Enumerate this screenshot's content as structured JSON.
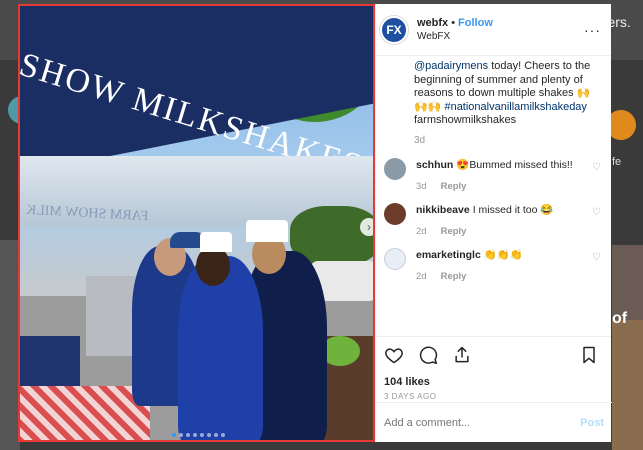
{
  "background": {
    "top_right_text": "omers.",
    "right_text": "fe",
    "right_big_text": "of"
  },
  "post": {
    "banner_text": "SHOW MILKSHAKES",
    "under_text": "FARM SHOW MILK"
  },
  "header": {
    "avatar_text": "FX",
    "username": "webfx",
    "bullet": "•",
    "follow_label": "Follow",
    "subname": "WebFX",
    "more_label": "···"
  },
  "caption": {
    "mention": "@padairymens",
    "text": " today! Cheers to the beginning of summer and plenty of reasons to down multiple shakes 🙌🙌🙌 ",
    "hashtag": "#nationalvanillamilkshakeday",
    "tail": " farmshowmilkshakes",
    "time": "3d"
  },
  "comments": [
    {
      "user": "schhun",
      "text": "😍Bummed missed this!!",
      "time": "3d",
      "reply": "Reply",
      "avatar_color": "#8a9aa6"
    },
    {
      "user": "nikkibeave",
      "text": "I missed it too 😂",
      "time": "2d",
      "reply": "Reply",
      "avatar_color": "#6b3b2c"
    },
    {
      "user": "emarketinglc",
      "text": "👏👏👏",
      "time": "2d",
      "reply": "Reply",
      "avatar_color": "#e7eef5"
    }
  ],
  "actions": {
    "likes": "104 likes",
    "date": "3 DAYS AGO"
  },
  "add_comment": {
    "placeholder": "Add a comment...",
    "post_label": "Post"
  },
  "colors": {
    "accent": "#3897f0",
    "highlight_border": "#e53935"
  }
}
